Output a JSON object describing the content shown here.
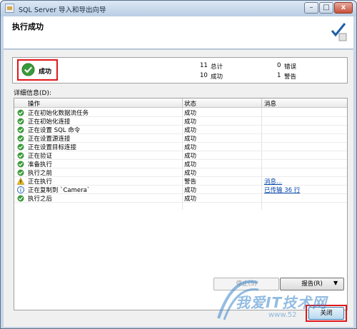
{
  "window": {
    "title": "SQL Server 导入和导出向导",
    "minimize": "–",
    "maximize": "□",
    "close": "x"
  },
  "header": {
    "title": "执行成功"
  },
  "status": {
    "result": "成功",
    "total_count": "11",
    "total_label": "总计",
    "success_count": "10",
    "success_label": "成功",
    "error_count": "0",
    "error_label": "错误",
    "warning_count": "1",
    "warning_label": "警告"
  },
  "details": {
    "label": "详细信息(D):",
    "columns": [
      "操作",
      "状态",
      "消息"
    ],
    "rows": [
      {
        "icon": "success-icon",
        "action": "正在初始化数据流任务",
        "status": "成功",
        "message": ""
      },
      {
        "icon": "success-icon",
        "action": "正在初始化连接",
        "status": "成功",
        "message": ""
      },
      {
        "icon": "success-icon",
        "action": "正在设置 SQL 命令",
        "status": "成功",
        "message": ""
      },
      {
        "icon": "success-icon",
        "action": "正在设置源连接",
        "status": "成功",
        "message": ""
      },
      {
        "icon": "success-icon",
        "action": "正在设置目标连接",
        "status": "成功",
        "message": ""
      },
      {
        "icon": "success-icon",
        "action": "正在验证",
        "status": "成功",
        "message": ""
      },
      {
        "icon": "success-icon",
        "action": "准备执行",
        "status": "成功",
        "message": ""
      },
      {
        "icon": "success-icon",
        "action": "执行之前",
        "status": "成功",
        "message": ""
      },
      {
        "icon": "warning-icon",
        "action": "正在执行",
        "status": "警告",
        "message": "消息..."
      },
      {
        "icon": "info-icon",
        "action": "正在复制到 `Camera`",
        "status": "成功",
        "message": "已传输 36 行"
      },
      {
        "icon": "success-icon",
        "action": "执行之后",
        "status": "成功",
        "message": ""
      }
    ]
  },
  "buttons": {
    "stop": "停止(S)",
    "report": "报告(R)",
    "report_arrow": "▼",
    "close": "关闭"
  },
  "watermark": {
    "text": "我爱IT技术网",
    "url": "www.52"
  }
}
